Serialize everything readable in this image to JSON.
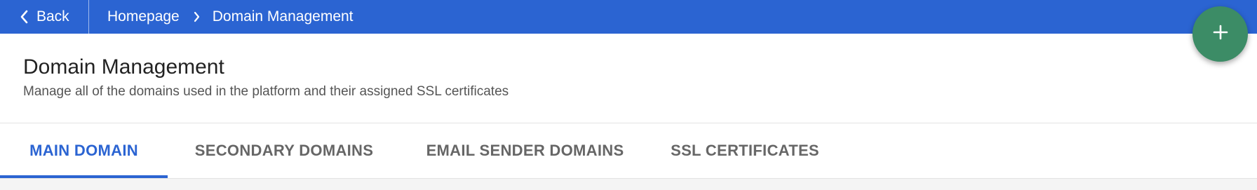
{
  "topbar": {
    "back_label": "Back",
    "breadcrumb": {
      "home": "Homepage",
      "current": "Domain Management"
    },
    "background_color": "#2b64d2"
  },
  "header": {
    "title": "Domain Management",
    "subtitle": "Manage all of the domains used in the platform and their assigned SSL certificates"
  },
  "tabs": [
    {
      "label": "MAIN DOMAIN",
      "active": true
    },
    {
      "label": "SECONDARY DOMAINS",
      "active": false
    },
    {
      "label": "EMAIL SENDER DOMAINS",
      "active": false
    },
    {
      "label": "SSL CERTIFICATES",
      "active": false
    }
  ],
  "fab": {
    "icon": "plus-icon",
    "color": "#3c8c66"
  },
  "icons": {
    "back": "chevron-left-icon",
    "breadcrumb_separator": "chevron-right-icon"
  }
}
